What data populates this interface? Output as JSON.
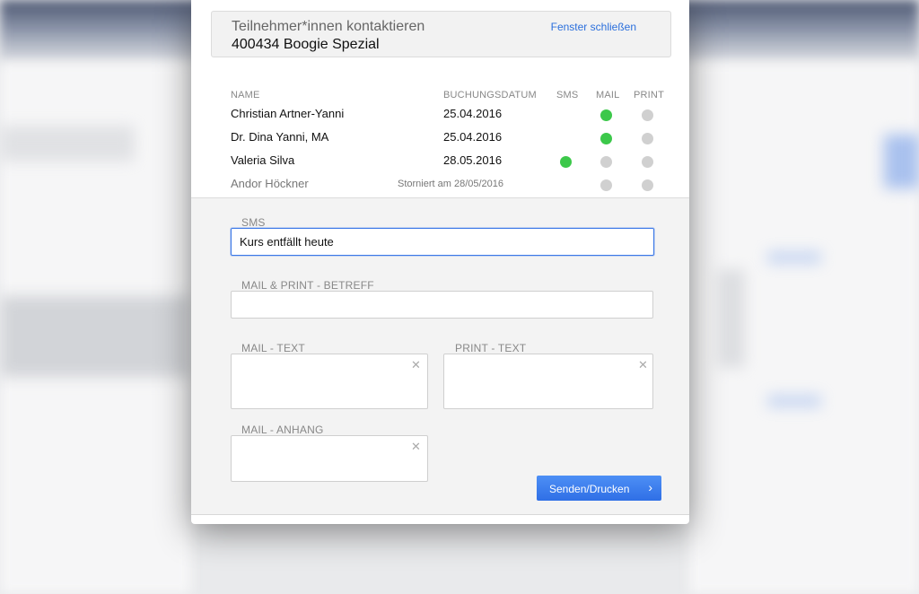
{
  "header": {
    "subtitle": "Teilnehmer*innen kontaktieren",
    "title": "400434 Boogie Spezial",
    "close_label": "Fenster schließen"
  },
  "table": {
    "columns": {
      "name": "NAME",
      "date": "BUCHUNGSDATUM",
      "sms": "SMS",
      "mail": "MAIL",
      "print": "PRINT"
    },
    "rows": [
      {
        "name": "Christian Artner-Yanni",
        "date": "25.04.2016",
        "sms": null,
        "mail": "active",
        "print": "inactive"
      },
      {
        "name": "Dr. Dina Yanni, MA",
        "date": "25.04.2016",
        "sms": null,
        "mail": "active",
        "print": "inactive"
      },
      {
        "name": "Valeria Silva",
        "date": "28.05.2016",
        "sms": "active",
        "mail": "inactive",
        "print": "inactive"
      },
      {
        "name": "Andor Höckner",
        "date": "Storniert am 28/05/2016",
        "sms": null,
        "mail": "inactive",
        "print": "inactive"
      }
    ]
  },
  "form": {
    "sms_label": "SMS",
    "sms_value": "Kurs entfällt heute",
    "subject_label": "MAIL & PRINT - BETREFF",
    "subject_value": "",
    "mail_text_label": "MAIL - TEXT",
    "print_text_label": "PRINT - TEXT",
    "attachment_label": "MAIL - ANHANG",
    "send_label": "Senden/Drucken"
  },
  "colors": {
    "active_dot": "#3cc84a",
    "inactive_dot": "#d0d0d0",
    "accent": "#2f6fe6"
  }
}
